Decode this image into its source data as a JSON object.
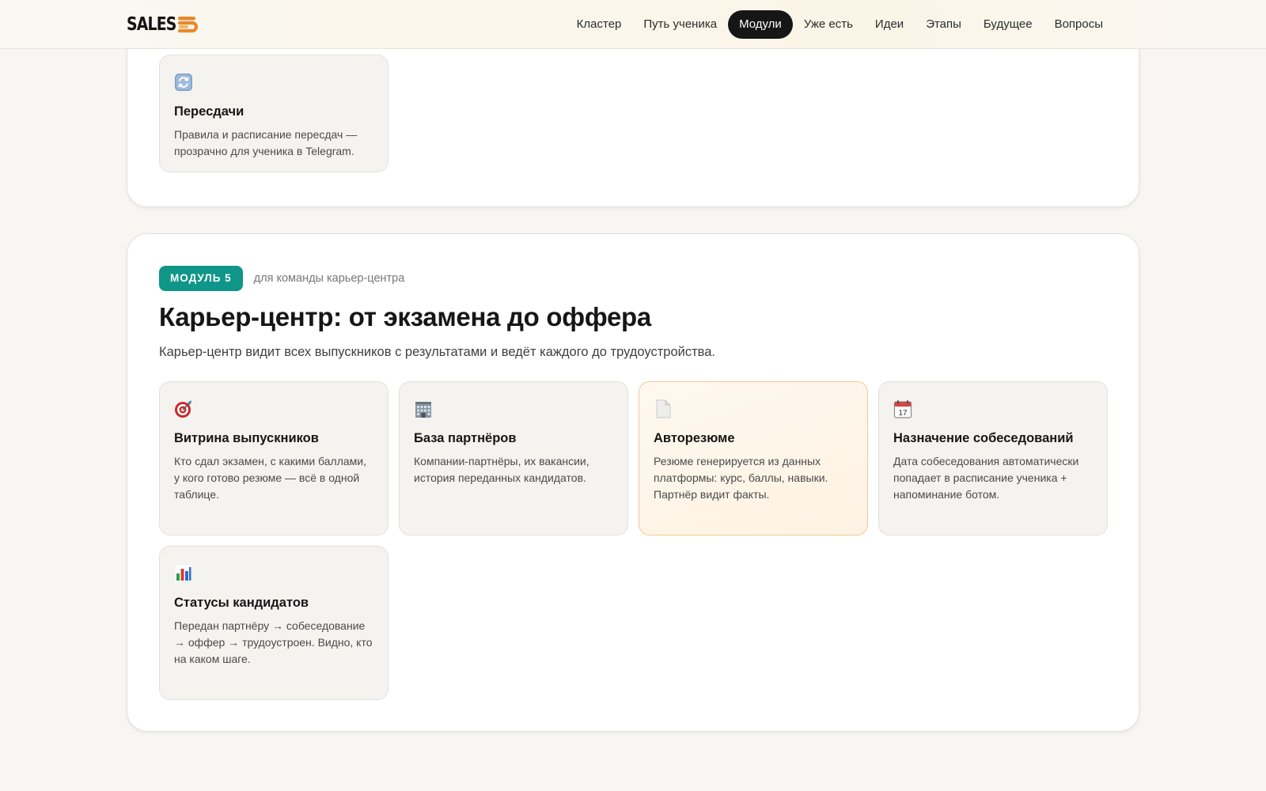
{
  "brand": {
    "logo_text": "SALES"
  },
  "nav": {
    "items": [
      {
        "label": "Кластер",
        "active": false
      },
      {
        "label": "Путь ученика",
        "active": false
      },
      {
        "label": "Модули",
        "active": true
      },
      {
        "label": "Уже есть",
        "active": false
      },
      {
        "label": "Идеи",
        "active": false
      },
      {
        "label": "Этапы",
        "active": false
      },
      {
        "label": "Будущее",
        "active": false
      },
      {
        "label": "Вопросы",
        "active": false
      }
    ]
  },
  "prev_section": {
    "cards": [
      {
        "icon": "refresh-icon",
        "title": "Пересдачи",
        "text": "Правила и расписание пересдач — прозрачно для ученика в Telegram."
      }
    ]
  },
  "module": {
    "badge": "МОДУЛЬ 5",
    "audience": "для команды карьер-центра",
    "title": "Карьер-центр: от экзамена до оффера",
    "description": "Карьер-центр видит всех выпускников с результатами и ведёт каждого до трудоустройства.",
    "cards": [
      {
        "icon": "target-icon",
        "title": "Витрина выпускников",
        "text": "Кто сдал экзамен, с какими баллами, у кого готово резюме — всё в одной таблице.",
        "highlight": false
      },
      {
        "icon": "building-icon",
        "title": "База партнёров",
        "text": "Компании-партнёры, их вакансии, история переданных кандидатов.",
        "highlight": false
      },
      {
        "icon": "document-icon",
        "title": "Авторезюме",
        "text": "Резюме генерируется из данных платформы: курс, баллы, навыки. Партнёр видит факты.",
        "highlight": true
      },
      {
        "icon": "calendar-icon",
        "title": "Назначение собеседований",
        "text": "Дата собеседования автоматически попадает в расписание ученика + напоминание ботом.",
        "highlight": false
      },
      {
        "icon": "bar-chart-icon",
        "title": "Статусы кандидатов",
        "text": "Передан партнёру → собеседование → оффер → трудоустроен. Видно, кто на каком шаге.",
        "highlight": false
      }
    ],
    "calendar_day": "17"
  },
  "colors": {
    "accent_teal": "#0f9688",
    "nav_active": "#161616",
    "highlight_border": "#f2c892",
    "logo_orange": "#e9892a"
  }
}
